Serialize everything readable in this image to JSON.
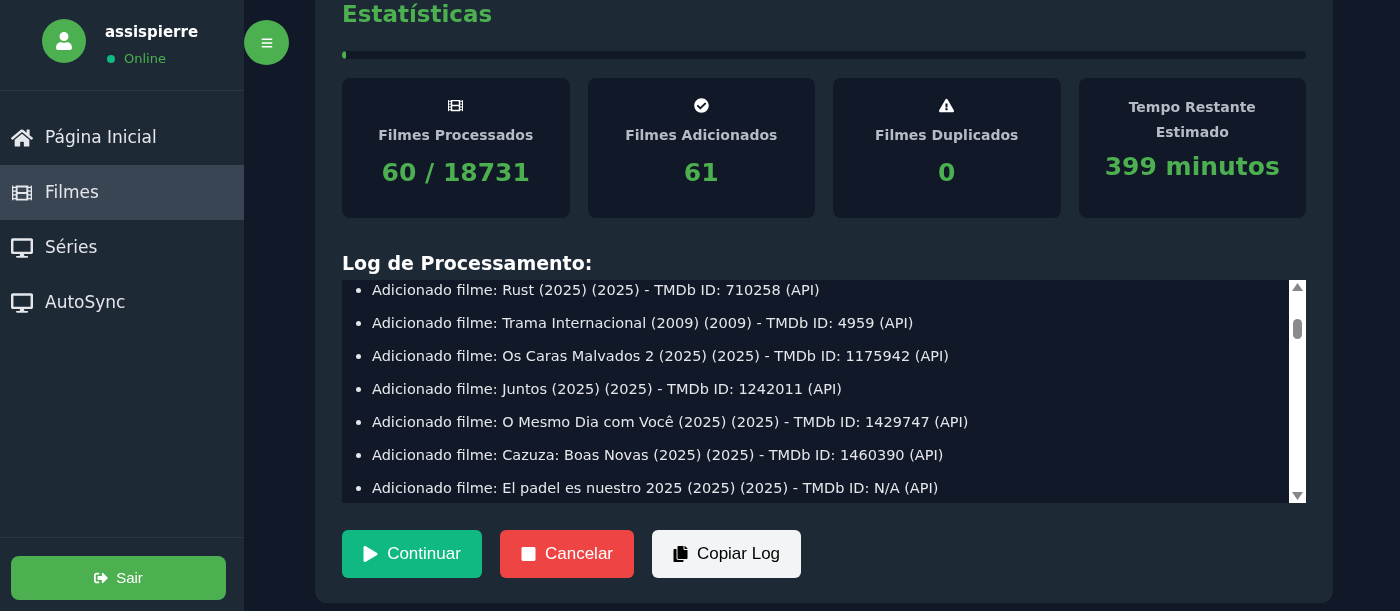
{
  "sidebar": {
    "user": {
      "name": "assispierre",
      "status": "Online"
    },
    "items": [
      {
        "label": "Página Inicial",
        "selected": false
      },
      {
        "label": "Filmes",
        "selected": true
      },
      {
        "label": "Séries",
        "selected": false
      },
      {
        "label": "AutoSync",
        "selected": false
      }
    ],
    "logout": "Sair"
  },
  "stats": {
    "title": "Estatísticas",
    "progress": {
      "level": 0.004
    },
    "cards": [
      {
        "label": "Filmes Processados",
        "value": "60 / 18731"
      },
      {
        "label": "Filmes Adicionados",
        "value": "61"
      },
      {
        "label": "Filmes Duplicados",
        "value": "0"
      },
      {
        "label": "Tempo Restante Estimado",
        "value": "399 minutos"
      }
    ]
  },
  "log": {
    "title": "Log de Processamento:",
    "entries": [
      "Adicionado filme: Rust (2025) (2025) - TMDb ID: 710258 (API)",
      "Adicionado filme: Trama Internacional (2009) (2009) - TMDb ID: 4959 (API)",
      "Adicionado filme: Os Caras Malvados 2 (2025) (2025) - TMDb ID: 1175942 (API)",
      "Adicionado filme: Juntos (2025) (2025) - TMDb ID: 1242011 (API)",
      "Adicionado filme: O Mesmo Dia com Você (2025) (2025) - TMDb ID: 1429747 (API)",
      "Adicionado filme: Cazuza: Boas Novas (2025) (2025) - TMDb ID: 1460390 (API)",
      "Adicionado filme: El padel es nuestro 2025 (2025) (2025) - TMDb ID: N/A (API)"
    ]
  },
  "actions": [
    "Continuar",
    "Cancelar",
    "Copiar Log"
  ]
}
